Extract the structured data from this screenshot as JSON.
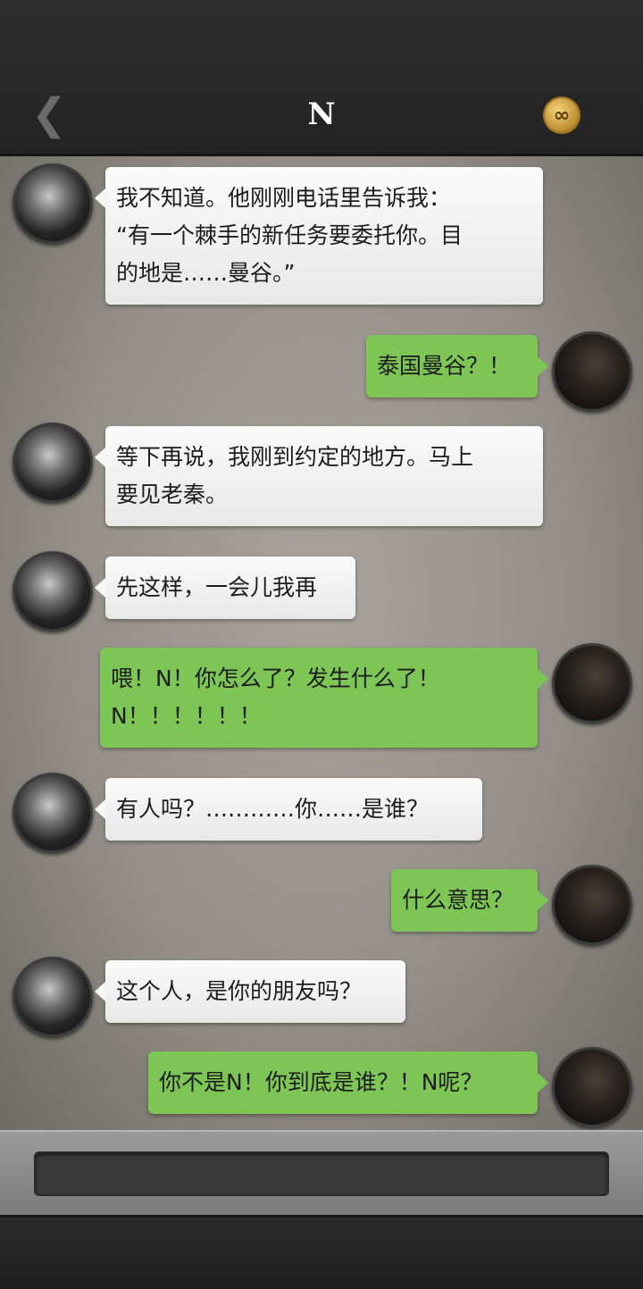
{
  "header": {
    "back_icon": "chevron-left-icon",
    "back_glyph": "❮",
    "title": "N",
    "coin_icon": "infinity-coin-icon",
    "coin_glyph": "∞"
  },
  "messages": [
    {
      "side": "left",
      "lines": [
        "我不知道。他刚刚电话里告诉我：",
        "“有一个棘手的新任务要委托你。目",
        "的地是……曼谷。”"
      ]
    },
    {
      "side": "right",
      "lines": [
        "泰国曼谷？！"
      ]
    },
    {
      "side": "left",
      "lines": [
        "等下再说，我刚到约定的地方。马上",
        "要见老秦。"
      ]
    },
    {
      "side": "left",
      "lines": [
        "先这样，一会儿我再"
      ]
    },
    {
      "side": "right",
      "lines": [
        "喂！N！你怎么了？发生什么了！",
        "N！！！！！！"
      ]
    },
    {
      "side": "left",
      "lines": [
        "有人吗？…………你……是谁？"
      ]
    },
    {
      "side": "right",
      "lines": [
        "什么意思？"
      ]
    },
    {
      "side": "left",
      "lines": [
        "这个人，是你的朋友吗？"
      ]
    },
    {
      "side": "right",
      "lines": [
        "你不是N！你到底是谁？！N呢？"
      ]
    }
  ],
  "input": {
    "value": "",
    "placeholder": ""
  },
  "colors": {
    "bubble_right": "#7dc656",
    "bubble_left": "#f2f2f2",
    "header_bg": "#2b2b2b"
  }
}
